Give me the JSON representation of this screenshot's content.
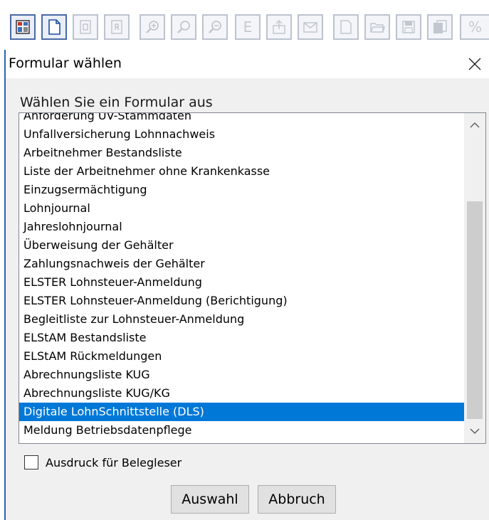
{
  "toolbar": {
    "buttons": [
      {
        "icon": "form-grid-icon",
        "active": true
      },
      {
        "icon": "blank-page-icon",
        "active": true
      },
      {
        "icon": "page-e-icon",
        "active": false
      },
      {
        "icon": "page-r-icon",
        "active": false
      },
      {
        "icon": "zoom-in-icon",
        "active": false
      },
      {
        "icon": "zoom-icon",
        "active": false
      },
      {
        "icon": "zoom-out-icon",
        "active": false
      },
      {
        "icon": "letter-e-icon",
        "active": false
      },
      {
        "icon": "export-icon",
        "active": false
      },
      {
        "icon": "mail-icon",
        "active": false
      },
      {
        "icon": "new-document-icon",
        "active": false
      },
      {
        "icon": "open-folder-icon",
        "active": false
      },
      {
        "icon": "save-icon",
        "active": false
      },
      {
        "icon": "copy-icon",
        "active": false
      },
      {
        "icon": "percent-icon",
        "active": false
      }
    ],
    "letter_e": "E",
    "percent": "%"
  },
  "dialog": {
    "title": "Formular wählen",
    "prompt": "Wählen Sie ein Formular aus",
    "items": [
      "Anforderung UV-Stammdaten",
      "Unfallversicherung Lohnnachweis",
      "Arbeitnehmer Bestandsliste",
      "Liste der Arbeitnehmer ohne Krankenkasse",
      "Einzugsermächtigung",
      "Lohnjournal",
      "Jahreslohnjournal",
      "Überweisung der Gehälter",
      "Zahlungsnachweis der Gehälter",
      "ELSTER Lohnsteuer-Anmeldung",
      "ELSTER Lohnsteuer-Anmeldung (Berichtigung)",
      "Begleitliste zur Lohnsteuer-Anmeldung",
      "ELStAM Bestandsliste",
      "ELStAM Rückmeldungen",
      "Abrechnungsliste KUG",
      "Abrechnungsliste KUG/KG",
      "Digitale LohnSchnittstelle (DLS)",
      "Meldung Betriebsdatenpflege"
    ],
    "selected_item": "Digitale LohnSchnittstelle (DLS)",
    "checkbox_label": "Ausdruck für Belegleser",
    "checkbox_checked": false,
    "select_button": "Auswahl",
    "cancel_button": "Abbruch"
  },
  "colors": {
    "selection": "#0078d7",
    "window_accent": "#2a63b8",
    "dialog_background": "#f0f0f0"
  }
}
